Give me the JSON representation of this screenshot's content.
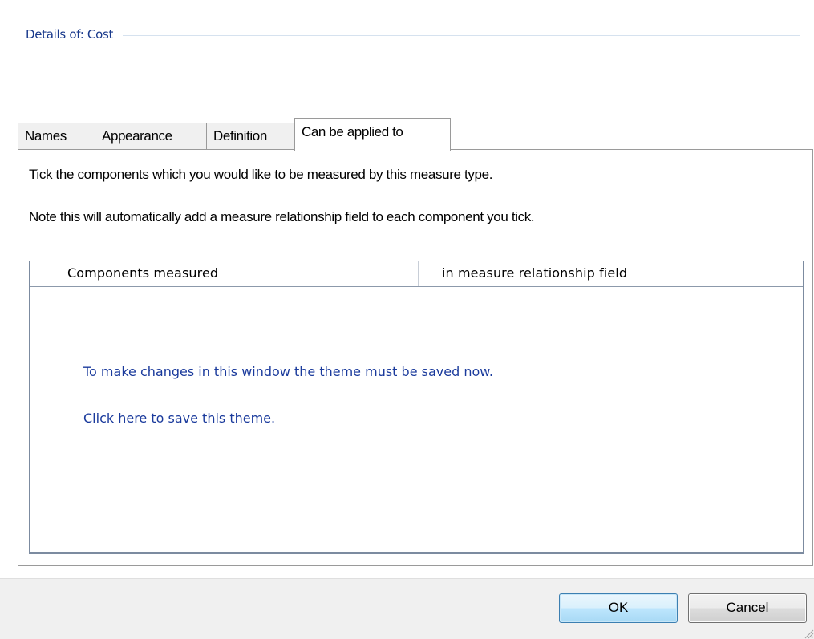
{
  "header": {
    "title": "Details of: Cost"
  },
  "tabs": [
    {
      "label": "Names",
      "active": false
    },
    {
      "label": "Appearance",
      "active": false
    },
    {
      "label": "Definition",
      "active": false
    },
    {
      "label": "Can be applied to",
      "active": true
    }
  ],
  "panel": {
    "instruction": "Tick the components which you would like to be measured by this measure type.",
    "note": "Note this will automatically add a measure relationship field to each component you tick.",
    "list": {
      "columns": [
        "Components measured",
        "in measure relationship field"
      ],
      "message": "To make changes in this window the theme must be saved now.",
      "link": "Click here to save this theme."
    }
  },
  "footer": {
    "ok_label": "OK",
    "cancel_label": "Cancel"
  },
  "colors": {
    "header_text": "#1a3a8c",
    "link_text": "#1a3a9c",
    "ok_border": "#3c7fb1",
    "footer_bg": "#f0f0f0"
  },
  "icons": {
    "resize_grip": "resize-grip-icon"
  }
}
